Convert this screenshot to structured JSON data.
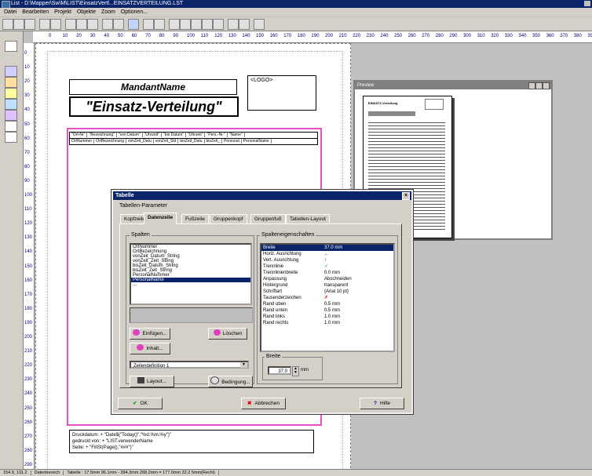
{
  "window": {
    "title": "List - D:\\Mapper\\Sw\\M\\LIST\\EinsatzVertl...EINSATZVERTEILUNG.LST"
  },
  "menu": [
    "Datei",
    "Bearbeiten",
    "Projekt",
    "Objekte",
    "Zoom",
    "Optionen..."
  ],
  "ruler": {
    "h": [
      "0",
      "10",
      "20",
      "30",
      "40",
      "50",
      "60",
      "70",
      "80",
      "90",
      "100",
      "110",
      "120",
      "130",
      "140",
      "150",
      "160",
      "170",
      "180",
      "190",
      "200",
      "210",
      "220",
      "230",
      "240",
      "250",
      "260",
      "270",
      "280",
      "290",
      "300",
      "310",
      "320",
      "330",
      "340",
      "350",
      "360",
      "370",
      "380",
      "390"
    ],
    "v": [
      "0",
      "10",
      "20",
      "30",
      "40",
      "50",
      "60",
      "70",
      "80",
      "90",
      "100",
      "110",
      "120",
      "130",
      "140",
      "150",
      "160",
      "170",
      "180",
      "190",
      "200",
      "210",
      "220",
      "230",
      "240",
      "250",
      "260",
      "270",
      "280",
      "290"
    ]
  },
  "page": {
    "mandant": "MandantName",
    "title": "\"Einsatz-Verteilung\"",
    "logo": "<LOGO>",
    "table_header": [
      "\"Ort-Nr\"",
      "\"Bezeichnung\"",
      "\"von Datum\"",
      "\"Uhrzeit\"",
      "\"bis Datum\"",
      "\"Uhrzeit\"",
      "\"Pers.-Nr.\"",
      "\"Name\""
    ],
    "table_data": [
      "OrtNummer",
      "OrtBezeichnung",
      "vonZeit_Datu",
      "vonZeit_Std",
      "bisZeit_Datu",
      "bisZeit_",
      "Personal",
      "PersonalName"
    ],
    "footer": [
      "Druckdatum: + \"Date$(\"Today()\",\"%d.%m.%y\")\"",
      "gedruckt von: + \"LIST.verwenderName",
      "Seite: + \"FillSt(Page(),\"###\")\""
    ]
  },
  "preview": {
    "title": "Preview",
    "page_heading": "EINSATZ-Verteilung"
  },
  "dialog": {
    "title": "Tabelle",
    "section_label": "Tabellen-Parameter",
    "tabs": [
      "Kopfzeile",
      "Datenzeile",
      "Fußzeile",
      "Gruppenkopf",
      "Gruppenfuß",
      "Tabellen-Layout"
    ],
    "columns_label": "Spalten",
    "columns": [
      "OrtNummer",
      "OrtBezeichnung",
      "vonZeit_Datum_String",
      "vonZeit_Zeit_String",
      "bisZeit_Datum_String",
      "bisZeit_Zeit_String",
      "PersonalNummer",
      "PersonalName",
      "..."
    ],
    "selected_column": "PersonalName",
    "insert_label": "Einfügen...",
    "delete_label": "Löschen",
    "content_label": "Inhalt...",
    "line_definition": "Zeilendefinition 1",
    "layout_label": "Layout...",
    "condition_label": "Bedingung...",
    "props_label": "Spalteneigenschaften",
    "properties": [
      {
        "k": "Breite",
        "v": "37.0 mm"
      },
      {
        "k": "Horiz. Ausrichtung",
        "v": "←"
      },
      {
        "k": "Vert. Ausrichtung",
        "v": "↑"
      },
      {
        "k": "Trennlinie",
        "v": "✓"
      },
      {
        "k": "Trennlinienbreite",
        "v": "0.0 mm"
      },
      {
        "k": "Anpassung",
        "v": "Abschneiden"
      },
      {
        "k": "Hintergrund",
        "v": "transparent"
      },
      {
        "k": "Schriftart",
        "v": "{Arial 10 pt}"
      },
      {
        "k": "Tausenderzeichen",
        "v": "✗"
      },
      {
        "k": "Rand oben",
        "v": "0.5 mm"
      },
      {
        "k": "Rand unten",
        "v": "0.5 mm"
      },
      {
        "k": "Rand links",
        "v": "1.0 mm"
      },
      {
        "k": "Rand rechts",
        "v": "1.0 mm"
      }
    ],
    "width_label": "Breite",
    "width_value": "37.0",
    "width_unit": "mm",
    "ok_label": "OK",
    "cancel_label": "Abbrechen",
    "help_label": "Hilfe"
  },
  "status": [
    "154.9, 131.2",
    "Datenbereich",
    "Tabelle : 17.5mm 96.1mm - 394.3mm 268.2mm = 177.0mm 22.2 5mm(Rechi)"
  ]
}
